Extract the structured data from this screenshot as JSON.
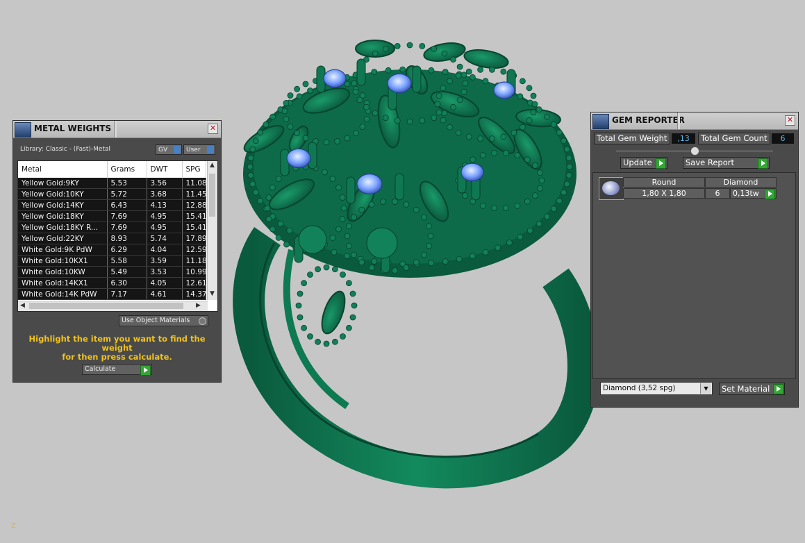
{
  "metal_weights": {
    "title": "METAL WEIGHTS",
    "library_label": "Library: Classic - (Fast)-Metal",
    "gv_label": "GV",
    "user_label": "User",
    "columns": [
      "Metal",
      "Grams",
      "DWT",
      "SPG"
    ],
    "rows": [
      [
        "Yellow Gold:9KY",
        "5.53",
        "3.56",
        "11.08"
      ],
      [
        "Yellow Gold:10KY",
        "5.72",
        "3.68",
        "11.45"
      ],
      [
        "Yellow Gold:14KY",
        "6.43",
        "4.13",
        "12.88"
      ],
      [
        "Yellow Gold:18KY",
        "7.69",
        "4.95",
        "15.41"
      ],
      [
        "Yellow Gold:18KY R...",
        "7.69",
        "4.95",
        "15.41"
      ],
      [
        "Yellow Gold:22KY",
        "8.93",
        "5.74",
        "17.89"
      ],
      [
        "White Gold:9K PdW",
        "6.29",
        "4.04",
        "12.59"
      ],
      [
        "White Gold:10KX1",
        "5.58",
        "3.59",
        "11.18"
      ],
      [
        "White Gold:10KW",
        "5.49",
        "3.53",
        "10.99"
      ],
      [
        "White Gold:14KX1",
        "6.30",
        "4.05",
        "12.61"
      ],
      [
        "White Gold:14K PdW",
        "7.17",
        "4.61",
        "14.37"
      ]
    ],
    "use_object_materials": "Use Object Materials",
    "hint_line1": "Highlight the item you want to find the weight",
    "hint_line2": "for then press calculate.",
    "calculate_label": "Calculate"
  },
  "gem_reporter": {
    "title": "GEM REPORTER",
    "total_weight_label": "Total Gem Weight",
    "total_weight_value": ",13",
    "total_count_label": "Total Gem Count",
    "total_count_value": "6",
    "update_label": "Update",
    "save_report_label": "Save Report",
    "gem_row": {
      "shape": "Round",
      "size": "1,80 X 1,80",
      "material": "Diamond",
      "count": "6",
      "weight": "0,13tw"
    },
    "material_select": "Diamond   (3,52 spg)",
    "set_material_label": "Set Material"
  },
  "viewport": {
    "axis_label": "Z",
    "ring_color": "#0c6a49",
    "gem_color": "#6f9bff"
  }
}
